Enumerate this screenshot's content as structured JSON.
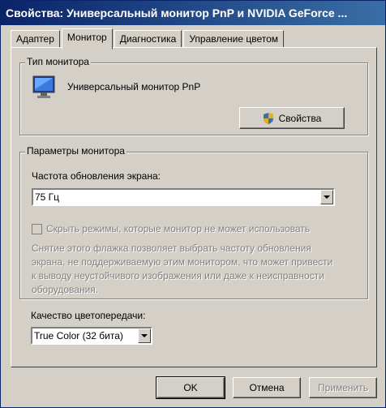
{
  "window": {
    "title": "Свойства: Универсальный монитор PnP и NVIDIA GeForce ..."
  },
  "tabs": [
    {
      "label": "Адаптер"
    },
    {
      "label": "Монитор"
    },
    {
      "label": "Диагностика"
    },
    {
      "label": "Управление цветом"
    }
  ],
  "active_tab": "Монитор",
  "monitor_type": {
    "group_label": "Тип монитора",
    "device_name": "Универсальный монитор PnP",
    "properties_button": "Свойства"
  },
  "monitor_settings": {
    "group_label": "Параметры монитора",
    "refresh_label": "Частота обновления экрана:",
    "refresh_value": "75 Гц",
    "hide_modes_label": "Скрыть режимы, которые монитор не может использовать",
    "hide_modes_checked": false,
    "description": "Снятие этого флажка позволяет выбрать частоту обновления экрана, не поддерживаемую этим монитором, что может привести к выводу неустойчивого изображения или даже к неисправности оборудования."
  },
  "color_quality": {
    "label": "Качество цветопередачи:",
    "value": "True Color (32 бита)"
  },
  "footer": {
    "ok": "OK",
    "cancel": "Отмена",
    "apply": "Применить"
  },
  "colors": {
    "titlebar_start": "#0a246a",
    "titlebar_end": "#3a6ea5",
    "face": "#d4d0c8"
  }
}
